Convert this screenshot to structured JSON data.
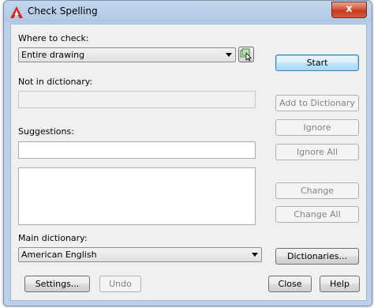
{
  "window": {
    "title": "Check Spelling",
    "close_glyph": "x"
  },
  "where": {
    "label": "Where to check:",
    "value": "Entire drawing",
    "select_objects_icon": "select-objects-icon"
  },
  "not_in_dictionary": {
    "label": "Not in dictionary:",
    "value": ""
  },
  "suggestions": {
    "label": "Suggestions:",
    "value": "",
    "list": []
  },
  "main_dictionary": {
    "label": "Main dictionary:",
    "value": "American English"
  },
  "buttons": {
    "start": "Start",
    "add_to_dictionary": "Add to Dictionary",
    "ignore": "Ignore",
    "ignore_all": "Ignore All",
    "change": "Change",
    "change_all": "Change All",
    "dictionaries": "Dictionaries...",
    "settings": "Settings...",
    "undo": "Undo",
    "close": "Close",
    "help": "Help"
  },
  "colors": {
    "frame": "#b9d1ea",
    "client": "#f0f0f0",
    "close_button": "#c7371a",
    "app_icon": "#d6281c"
  }
}
